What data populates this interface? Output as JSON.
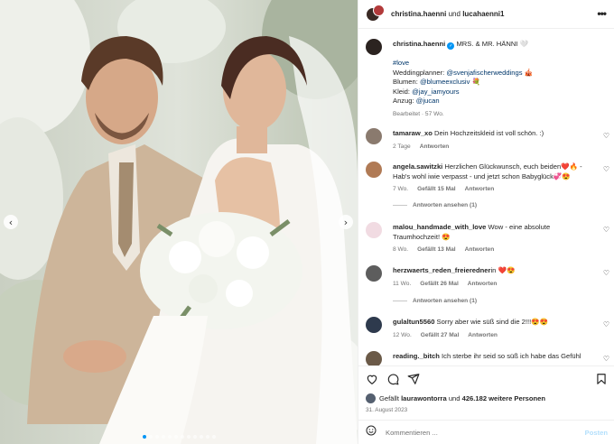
{
  "colors": {
    "accent": "#0095f6",
    "text": "#262626",
    "muted": "#737373",
    "link": "#00376b",
    "heart": "#ed4956"
  },
  "photo": {
    "slide_count": 12,
    "active_index": 0,
    "prev_icon": "chevron-left-icon",
    "next_icon": "chevron-right-icon"
  },
  "header": {
    "user1": "christina.haenni",
    "conjunction": "und",
    "user2": "lucahaenni1",
    "more_icon": "more-horizontal-icon"
  },
  "caption": {
    "username": "christina.haenni",
    "title": "MRS. & MR. HÄNNI 🤍",
    "hashtag": "#love",
    "lines": [
      {
        "label": "Weddingplanner: ",
        "link": "@svenjafischerweddings",
        "suffix": " 🎪"
      },
      {
        "label": "Blumen: ",
        "link": "@blumeexclusiv",
        "suffix": " 💐"
      },
      {
        "label": "Kleid: ",
        "link": "@jay_iamyours",
        "suffix": ""
      },
      {
        "label": "Anzug: ",
        "link": "@jucan",
        "suffix": ""
      }
    ],
    "meta": "Bearbeitet · 57 Wo."
  },
  "comments": [
    {
      "user": "tamaraw_xo",
      "text": "Dein Hochzeitskleid ist voll schön. :)",
      "time": "2 Tage",
      "likes": "",
      "reply": "Antworten",
      "view_replies": ""
    },
    {
      "user": "angela.sawitzki",
      "text": "Herzlichen Glückwunsch, euch beiden❤️🔥 - Hab's wohl iwie verpasst - und jetzt schon Babyglück💞😍",
      "time": "7 Wo.",
      "likes": "Gefällt 15 Mal",
      "reply": "Antworten",
      "view_replies": "Antworten ansehen (1)"
    },
    {
      "user": "malou_handmade_with_love",
      "text": "Wow - eine absolute Traumhochzeit! 😍",
      "time": "8 Wo.",
      "likes": "Gefällt 13 Mal",
      "reply": "Antworten",
      "view_replies": ""
    },
    {
      "user": "herzwaerts_reden_freieredner",
      "text": "in ❤️😍",
      "time": "11 Wo.",
      "likes": "Gefällt 26 Mal",
      "reply": "Antworten",
      "view_replies": "Antworten ansehen (1)"
    },
    {
      "user": "gulaltun5560",
      "text": "Sorry aber wie süß sind die 2!!!😍😍",
      "time": "12 Wo.",
      "likes": "Gefällt 27 Mal",
      "reply": "Antworten",
      "view_replies": ""
    },
    {
      "user": "reading._bitch",
      "text": "Ich sterbe ihr seid so süß ich habe das Gefühl",
      "time": "",
      "likes": "",
      "reply": "",
      "view_replies": ""
    }
  ],
  "actions": {
    "like_icon": "heart-icon",
    "comment_icon": "comment-icon",
    "share_icon": "share-icon",
    "save_icon": "bookmark-icon"
  },
  "likes": {
    "prefix": "Gefällt ",
    "user": "laurawontorra",
    "middle": " und ",
    "count": "426.182 weitere Personen"
  },
  "date": "31. August 2023",
  "comment_box": {
    "placeholder": "Kommentieren ...",
    "post_label": "Posten",
    "emoji_icon": "smiley-icon"
  }
}
